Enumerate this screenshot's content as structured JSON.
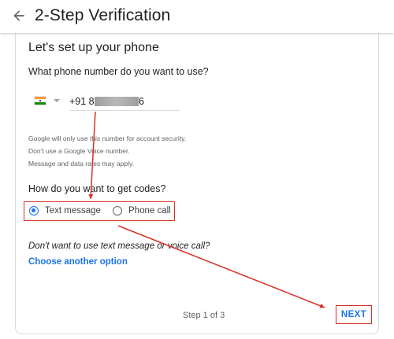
{
  "header": {
    "title": "2-Step Verification",
    "back_icon": "arrow-back-icon"
  },
  "content": {
    "heading": "Let's set up your phone",
    "phone_question": "What phone number do you want to use?",
    "country_flag": "india-flag-icon",
    "phone_prefix": "+91 8",
    "phone_suffix": "6",
    "notes": [
      "Google will only use this number for account security.",
      "Don't use a Google Voice number.",
      "Message and data rates may apply."
    ],
    "codes_question": "How do you want to get codes?",
    "options": [
      {
        "label": "Text message",
        "selected": true
      },
      {
        "label": "Phone call",
        "selected": false
      }
    ],
    "alternative_question": "Don't want to use text message or voice call?",
    "alternative_link": "Choose another option"
  },
  "footer": {
    "step_text": "Step 1 of 3",
    "next_label": "NEXT"
  },
  "colors": {
    "accent": "#1a73e8",
    "annotation_red": "#d93025"
  }
}
